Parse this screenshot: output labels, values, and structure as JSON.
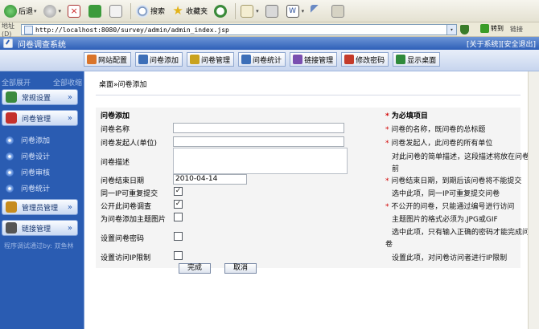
{
  "browser": {
    "back_label": "后退",
    "search_label": "搜索",
    "favorites_label": "收藏夹",
    "address_label": "地址(D)",
    "url": "http://localhost:8080/survey/admin/admin_index.jsp",
    "go_label": "转到",
    "links_label": "链接"
  },
  "app": {
    "title": "问卷调查系统",
    "about": "[关于系统]",
    "logout": "[安全退出]"
  },
  "nav": [
    {
      "label": "网站配置",
      "icon": "site-config-icon",
      "color": "#d9742a"
    },
    {
      "label": "问卷添加",
      "icon": "survey-add-icon",
      "color": "#3d6fb8"
    },
    {
      "label": "问卷管理",
      "icon": "survey-manage-icon",
      "color": "#c9a21d"
    },
    {
      "label": "问卷统计",
      "icon": "survey-stats-icon",
      "color": "#3d6fb8"
    },
    {
      "label": "链接管理",
      "icon": "link-manage-icon",
      "color": "#7a4fb0"
    },
    {
      "label": "修改密码",
      "icon": "password-icon",
      "color": "#c43a2a"
    },
    {
      "label": "显示桌面",
      "icon": "desktop-icon",
      "color": "#2f8a3b"
    }
  ],
  "sidebar": {
    "expand_all": "全部展开",
    "collapse_all": "全部收缩",
    "groups": [
      {
        "label": "常规设置",
        "icon": "settings-icon",
        "color": "#3b8a3e"
      },
      {
        "label": "问卷管理",
        "icon": "survey-icon",
        "color": "#c4312c"
      },
      {
        "label": "管理员管理",
        "icon": "admin-icon",
        "color": "#c78c1e"
      },
      {
        "label": "链接管理",
        "icon": "link-icon",
        "color": "#555555"
      }
    ],
    "sub_items": [
      "问卷添加",
      "问卷设计",
      "问卷审核",
      "问卷统计"
    ],
    "tester_prefix": "程序调试通过by:",
    "tester_name": "双鱼林"
  },
  "breadcrumb": "桌面»问卷添加",
  "form": {
    "section_title": "问卷添加",
    "required_title": "为必填项目",
    "fields": {
      "name_label": "问卷名称",
      "name_value": "",
      "sponsor_label": "问卷发起人(单位)",
      "sponsor_value": "",
      "desc_label": "问卷描述",
      "desc_value": "",
      "end_date_label": "问卷结束日期",
      "end_date_value": "2010-04-14",
      "repeat_label": "同一IP可重复提交",
      "public_label": "公开此问卷调查",
      "image_label": "为问卷添加主题图片",
      "password_label": "设置问卷密码",
      "ip_limit_label": "设置访问IP限制"
    },
    "notes": {
      "name": "问卷的名称，既问卷的总标题",
      "sponsor": "问卷发起人，此问卷的所有单位",
      "desc_1": "对此问卷的简单描述，这段描述将放在问卷",
      "desc_2": "前",
      "end_1": "问卷结束日期，到期后该问卷将不能提交",
      "end_2": "选中此项，同一IP可重复提交问卷",
      "public_1": "不公开的问卷，只能通过编号进行访问",
      "public_2": "主题图片的格式必须为.JPG或GIF",
      "password_1": "选中此项，只有输入正确的密码才能完成问",
      "password_2": "卷",
      "ip_limit": "设置此项，对问卷访问者进行IP限制"
    },
    "submit_label": "完成",
    "cancel_label": "取消"
  }
}
